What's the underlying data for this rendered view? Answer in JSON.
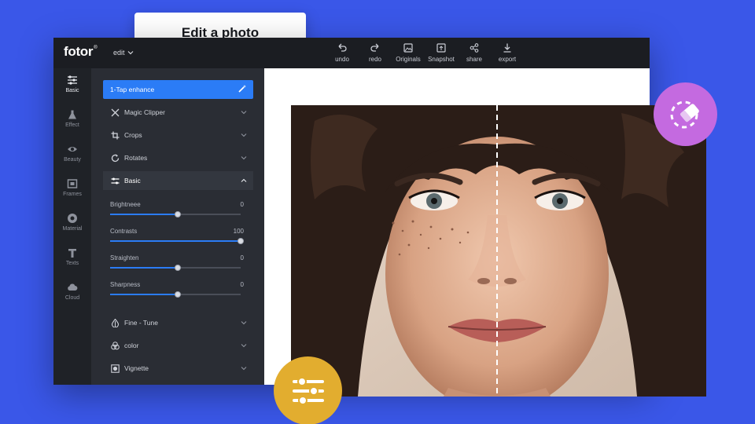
{
  "callout": {
    "text": "Edit a photo"
  },
  "app": {
    "logo": "fotor",
    "logo_mark": "®",
    "menu_label": "edit"
  },
  "toolbar": [
    {
      "label": "undo",
      "icon": "undo-icon"
    },
    {
      "label": "redo",
      "icon": "redo-icon"
    },
    {
      "label": "Originals",
      "icon": "image-icon"
    },
    {
      "label": "Snapshot",
      "icon": "snapshot-icon"
    },
    {
      "label": "share",
      "icon": "share-icon"
    },
    {
      "label": "export",
      "icon": "download-icon"
    }
  ],
  "sidebar": [
    {
      "label": "Basic",
      "icon": "sliders-icon",
      "active": true
    },
    {
      "label": "Effect",
      "icon": "flask-icon"
    },
    {
      "label": "Beauty",
      "icon": "eye-icon"
    },
    {
      "label": "Frames",
      "icon": "frame-icon"
    },
    {
      "label": "Material",
      "icon": "circle-icon"
    },
    {
      "label": "Texts",
      "icon": "text-icon"
    },
    {
      "label": "Cloud",
      "icon": "cloud-icon"
    }
  ],
  "panel": {
    "enhance_label": "1-Tap enhance",
    "sections": {
      "magic": "Magic Clipper",
      "crops": "Crops",
      "rotates": "Rotates",
      "basic": "Basic",
      "fine": "Fine - Tune",
      "color": "color",
      "vignette": "Vignette"
    },
    "sliders": [
      {
        "label": "Brightneee",
        "value": "0",
        "fraction": 0.52
      },
      {
        "label": "Contrasts",
        "value": "100",
        "fraction": 1.0
      },
      {
        "label": "Straighten",
        "value": "0",
        "fraction": 0.52
      },
      {
        "label": "Sharpness",
        "value": "0",
        "fraction": 0.52
      }
    ]
  },
  "colors": {
    "background": "#3a57e8",
    "accent": "#2b7cf6",
    "eraser_bubble": "#c46ae0",
    "sliders_bubble": "#e2ad2f"
  }
}
